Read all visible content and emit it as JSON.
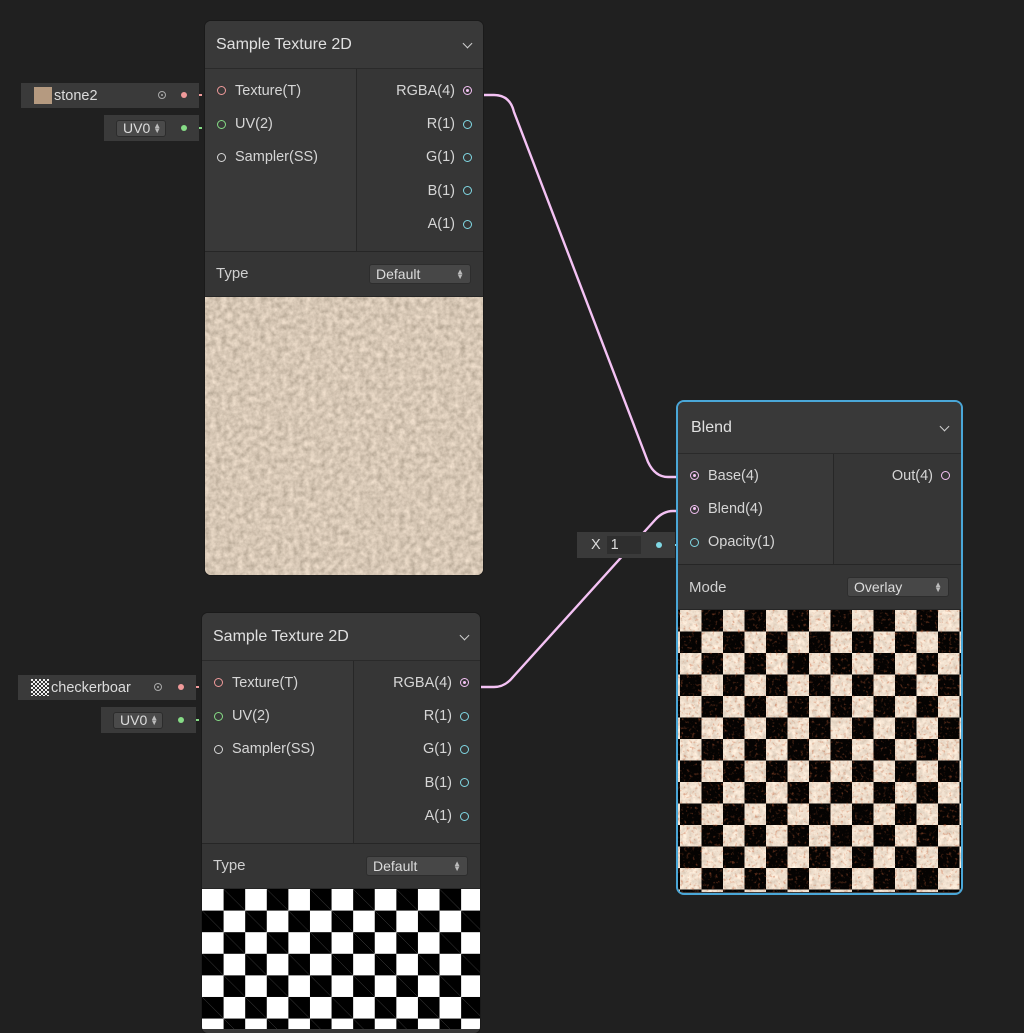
{
  "colors": {
    "background": "#202020",
    "selected_outline": "#4aa7d8",
    "texture_port": "#f09a9a",
    "uv_port": "#86dc86",
    "sampler_port": "#d8d8d8",
    "vector4_port": "#f4c2f4",
    "vector1_port": "#80d8e4"
  },
  "nodes": {
    "sample1": {
      "title": "Sample Texture 2D",
      "inputs": [
        "Texture(T)",
        "UV(2)",
        "Sampler(SS)"
      ],
      "outputs": [
        "RGBA(4)",
        "R(1)",
        "G(1)",
        "B(1)",
        "A(1)"
      ],
      "type_label": "Type",
      "type_value": "Default",
      "texture_field": "stone2",
      "uv_field": "UV0"
    },
    "sample2": {
      "title": "Sample Texture 2D",
      "inputs": [
        "Texture(T)",
        "UV(2)",
        "Sampler(SS)"
      ],
      "outputs": [
        "RGBA(4)",
        "R(1)",
        "G(1)",
        "B(1)",
        "A(1)"
      ],
      "type_label": "Type",
      "type_value": "Default",
      "texture_field": "checkerboar",
      "uv_field": "UV0"
    },
    "blend": {
      "title": "Blend",
      "inputs": [
        "Base(4)",
        "Blend(4)",
        "Opacity(1)"
      ],
      "outputs": [
        "Out(4)"
      ],
      "mode_label": "Mode",
      "mode_value": "Overlay",
      "opacity_axis": "X",
      "opacity_value": "1"
    }
  },
  "icons": {
    "collapse": "chevron-down-icon",
    "object_picker": "target-circle-icon",
    "stepper": "updown-arrows-icon"
  }
}
